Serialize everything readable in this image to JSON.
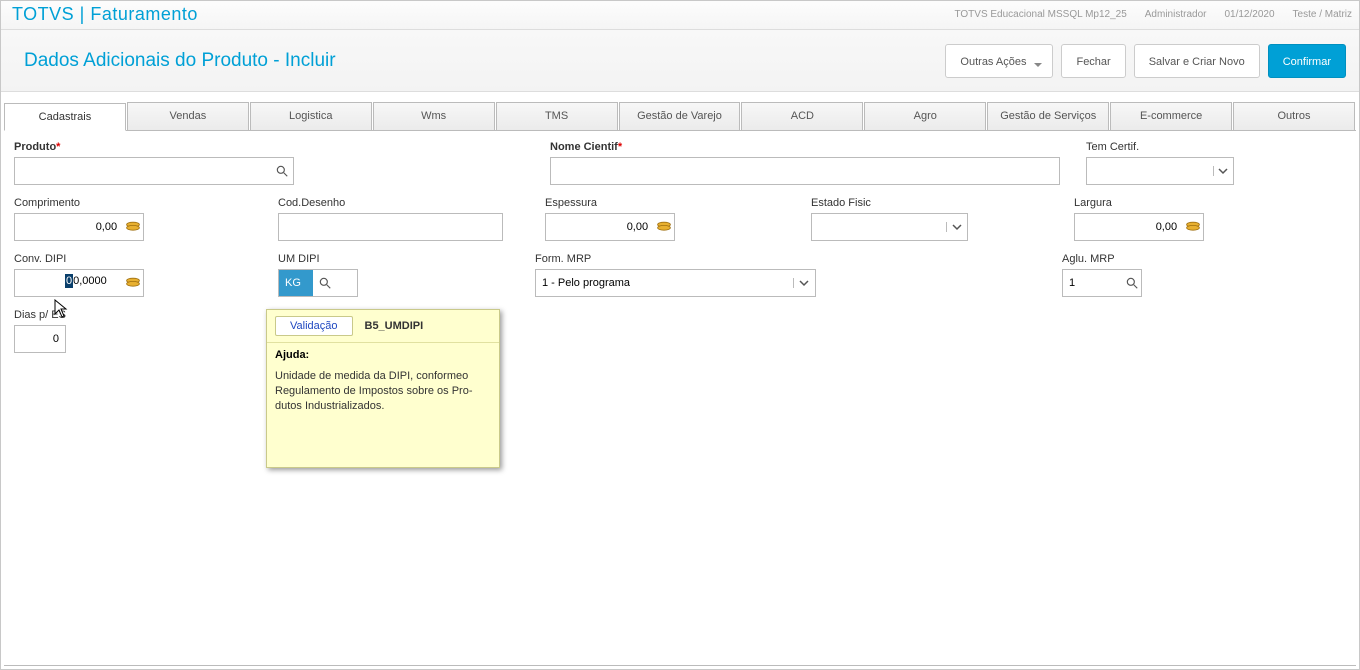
{
  "topbar": {
    "title": "TOTVS | Faturamento",
    "env": "TOTVS Educacional MSSQL Mp12_25",
    "user": "Administrador",
    "date": "01/12/2020",
    "branch": "Teste / Matriz"
  },
  "actionbar": {
    "title": "Dados Adicionais do Produto - Incluir",
    "other": "Outras Ações",
    "close": "Fechar",
    "saveNew": "Salvar e Criar Novo",
    "confirm": "Confirmar"
  },
  "tabs": [
    "Cadastrais",
    "Vendas",
    "Logistica",
    "Wms",
    "TMS",
    "Gestão de Varejo",
    "ACD",
    "Agro",
    "Gestão de Serviços",
    "E-commerce",
    "Outros"
  ],
  "active_tab": 0,
  "labels": {
    "produto": "Produto",
    "nomeCientif": "Nome Cientif",
    "temCertif": "Tem Certif.",
    "comprimento": "Comprimento",
    "codDesenho": "Cod.Desenho",
    "espessura": "Espessura",
    "estadoFisic": "Estado Fisic",
    "largura": "Largura",
    "convDipi": "Conv. DIPI",
    "umDipi": "UM DIPI",
    "formMrp": "Form. MRP",
    "agluMrp": "Aglu. MRP",
    "diasPEs": "Dias p/ ES"
  },
  "values": {
    "produto": "",
    "nomeCientif": "",
    "temCertif": "",
    "comprimento": "0,00",
    "codDesenho": "",
    "espessura": "0,00",
    "estadoFisic": "",
    "largura": "0,00",
    "convDipi": "0,0000",
    "umDipi": "KG",
    "formMrp": "1 - Pelo programa",
    "agluMrp": "1",
    "diasPEs": "0"
  },
  "help": {
    "validacao": "Validação",
    "field": "B5_UMDIPI",
    "ajuda": "Ajuda:",
    "text": "Unidade de medida da DIPI, conformeo Regulamento de Impostos sobre os  Pro-dutos Industrializados."
  }
}
